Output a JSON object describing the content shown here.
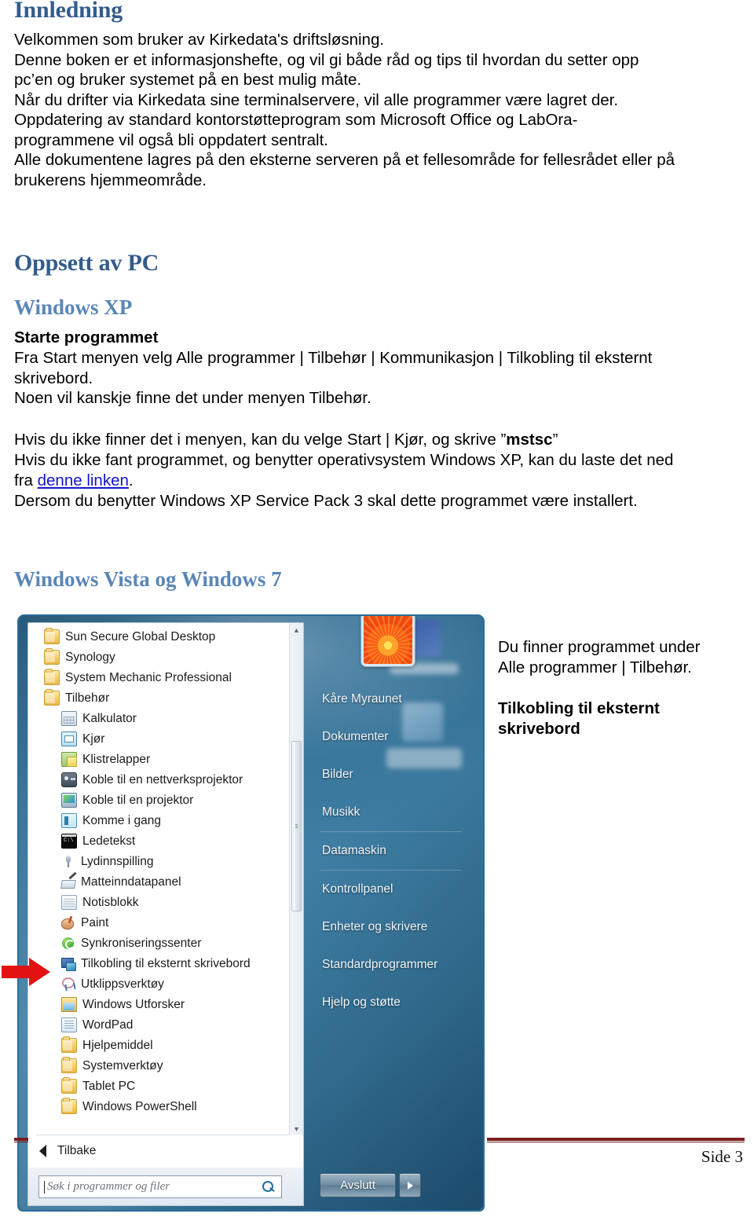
{
  "document": {
    "sections": [
      {
        "heading": "Innledning",
        "heading_color": "#335C8C",
        "paragraph": "Velkommen som bruker av Kirkedata's driftsløsning.\nDenne boken er et informasjonshefte, og vil gi både råd og tips til hvordan du setter opp\npc’en og bruker systemet på en best mulig måte.\nNår du drifter via Kirkedata sine terminalservere, vil alle programmer være lagret der.\nOppdatering av standard kontorstøtteprogram som Microsoft Office og LabOra-\nprogrammene vil også bli oppdatert sentralt.\nAlle dokumentene lagres på den eksterne serveren på et fellesområde for fellesrådet eller på\nbrukerens hjemmeområde."
      }
    ],
    "heading_oppsett": "Oppsett av PC",
    "heading_windows_xp": "Windows XP",
    "subheading_starte": "Starte programmet",
    "xp_paragraph_1": "Fra Start menyen velg Alle programmer | Tilbehør | Kommunikasjon | Tilkobling til eksternt\nskrivebord.\nNoen vil kanskje finne det under menyen Tilbehør.",
    "xp_line_mstsc_pre": "Hvis du ikke finner det i menyen, kan du velge Start | Kjør, og skrive ”",
    "xp_line_mstsc_code": "mstsc",
    "xp_line_mstsc_post": "”",
    "xp_line_download_pre": "Hvis du ikke fant programmet, og benytter operativsystem Windows XP, kan du laste det ned\nfra ",
    "xp_link_text": "denne linken",
    "xp_line_download_post": ".",
    "xp_line_sp3": "Dersom du benytter Windows XP Service Pack 3 skal dette programmet være installert.",
    "heading_windows_vista": "Windows Vista og Windows 7",
    "side_note_1": "Du finner programmet under\nAlle programmer | Tilbehør.",
    "side_note_2": "Tilkobling til eksternt\nskrivebord",
    "footer": {
      "page_label": "Side 3",
      "rule_color": "#7b1f1f"
    }
  },
  "start_menu": {
    "programs": [
      {
        "label": "Sun Secure Global Desktop",
        "icon": "folder-icon",
        "indent": false
      },
      {
        "label": "Synology",
        "icon": "folder-icon",
        "indent": false
      },
      {
        "label": "System Mechanic Professional",
        "icon": "folder-icon",
        "indent": false
      },
      {
        "label": "Tilbehør",
        "icon": "folder-icon",
        "indent": false
      },
      {
        "label": "Kalkulator",
        "icon": "calculator-icon",
        "indent": true
      },
      {
        "label": "Kjør",
        "icon": "run-icon",
        "indent": true
      },
      {
        "label": "Klistrelapper",
        "icon": "sticky-notes-icon",
        "indent": true
      },
      {
        "label": "Koble til en nettverksprojektor",
        "icon": "network-projector-icon",
        "indent": true
      },
      {
        "label": "Koble til en projektor",
        "icon": "projector-icon",
        "indent": true
      },
      {
        "label": "Komme i gang",
        "icon": "getting-started-icon",
        "indent": true
      },
      {
        "label": "Ledetekst",
        "icon": "command-prompt-icon",
        "indent": true
      },
      {
        "label": "Lydinnspilling",
        "icon": "microphone-icon",
        "indent": true
      },
      {
        "label": "Matteinndatapanel",
        "icon": "math-input-icon",
        "indent": true
      },
      {
        "label": "Notisblokk",
        "icon": "notepad-icon",
        "indent": true
      },
      {
        "label": "Paint",
        "icon": "paint-icon",
        "indent": true
      },
      {
        "label": "Synkroniseringssenter",
        "icon": "sync-center-icon",
        "indent": true
      },
      {
        "label": "Tilkobling til eksternt skrivebord",
        "icon": "remote-desktop-icon",
        "indent": true
      },
      {
        "label": "Utklippsverktøy",
        "icon": "snipping-tool-icon",
        "indent": true
      },
      {
        "label": "Windows Utforsker",
        "icon": "explorer-icon",
        "indent": true
      },
      {
        "label": "WordPad",
        "icon": "wordpad-icon",
        "indent": true
      },
      {
        "label": "Hjelpemiddel",
        "icon": "folder-icon",
        "indent": true
      },
      {
        "label": "Systemverktøy",
        "icon": "folder-icon",
        "indent": true
      },
      {
        "label": "Tablet PC",
        "icon": "folder-icon",
        "indent": true
      },
      {
        "label": "Windows PowerShell",
        "icon": "folder-icon",
        "indent": true
      }
    ],
    "back_label": "Tilbake",
    "search_placeholder": "Søk i programmer og filer",
    "search_value": "",
    "user_name": "Kåre Myraunet",
    "right_items": [
      {
        "label": "Kåre Myraunet",
        "separator_after": false
      },
      {
        "label": "Dokumenter",
        "separator_after": false
      },
      {
        "label": "Bilder",
        "separator_after": false
      },
      {
        "label": "Musikk",
        "separator_after": true
      },
      {
        "label": "Datamaskin",
        "separator_after": true
      },
      {
        "label": "Kontrollpanel",
        "separator_after": false
      },
      {
        "label": "Enheter og skrivere",
        "separator_after": false
      },
      {
        "label": "Standardprogrammer",
        "separator_after": false
      },
      {
        "label": "Hjelp og støtte",
        "separator_after": false
      }
    ],
    "shutdown_label": "Avslutt"
  }
}
